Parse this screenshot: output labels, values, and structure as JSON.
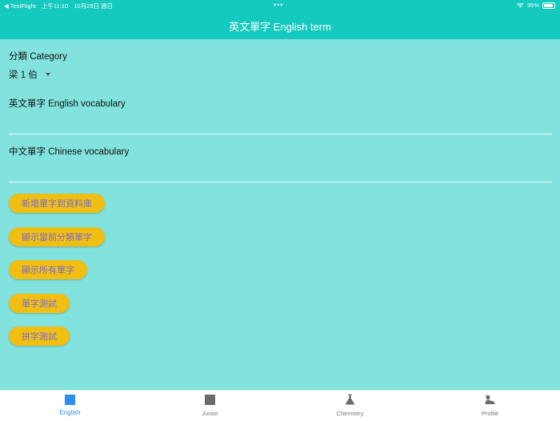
{
  "status_bar": {
    "back_app": "◀ TestFlight",
    "time": "上午11:10",
    "date": "10月29日 週日",
    "more": "•••",
    "battery": "95%"
  },
  "app_bar": {
    "title": "英文單字 English term"
  },
  "form": {
    "category_label": "分類 Category",
    "category_value": "梁 1 伯",
    "english_label": "英文單字 English vocabulary",
    "english_value": "",
    "chinese_label": "中文單字 Chinese vocabulary",
    "chinese_value": ""
  },
  "actions": [
    {
      "label": "新增單字到資料庫"
    },
    {
      "label": "顯示當前分類單字"
    },
    {
      "label": "顯示所有單字"
    },
    {
      "label": "單字測試"
    },
    {
      "label": "拼字測試"
    }
  ],
  "tabs": [
    {
      "label": "English",
      "icon": "square-icon",
      "active": true
    },
    {
      "label": "Junior",
      "icon": "square-icon",
      "active": false
    },
    {
      "label": "Chemistry",
      "icon": "flask-icon",
      "active": false
    },
    {
      "label": "Profile",
      "icon": "profile-icon",
      "active": false
    }
  ],
  "colors": {
    "app_bar": "#14c9bd",
    "background": "#82e3de",
    "button": "#f0bf12",
    "button_text": "#7a6cd0",
    "tab_active": "#2d8ef0"
  }
}
